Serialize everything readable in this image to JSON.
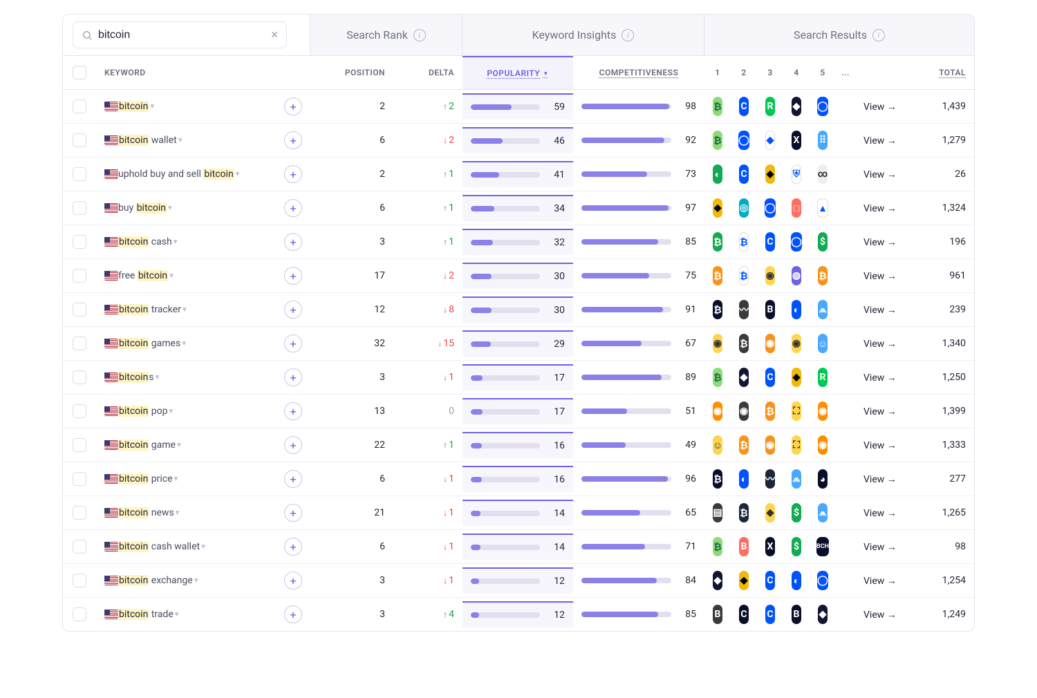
{
  "search": {
    "value": "bitcoin",
    "placeholder": ""
  },
  "topTabs": {
    "searchRank": "Search Rank",
    "keywordInsights": "Keyword Insights",
    "searchResults": "Search Results"
  },
  "columns": {
    "keyword": "KEYWORD",
    "position": "POSITION",
    "delta": "DELTA",
    "popularity": "POPULARITY",
    "competitiveness": "COMPETITIVENESS",
    "appCols": [
      "1",
      "2",
      "3",
      "4",
      "5"
    ],
    "moreCol": "...",
    "total": "TOTAL"
  },
  "sort": {
    "column": "popularity",
    "direction": "desc"
  },
  "viewLabel": "View →",
  "rows": [
    {
      "pre": "",
      "hl": "bitcoin",
      "post": "",
      "pos": 2,
      "delta": 2,
      "pop": 59,
      "comp": 98,
      "total": "1,439",
      "icons": [
        {
          "l": "₿",
          "c": 13
        },
        {
          "l": "C",
          "c": 2
        },
        {
          "l": "R",
          "c": 3
        },
        {
          "l": "◆",
          "c": 4
        },
        {
          "l": "◯",
          "c": 2
        }
      ]
    },
    {
      "pre": "",
      "hl": "bitcoin",
      "post": " wallet",
      "pos": 6,
      "delta": -2,
      "pop": 46,
      "comp": 92,
      "total": "1,279",
      "icons": [
        {
          "l": "₿",
          "c": 13
        },
        {
          "l": "◯",
          "c": 2
        },
        {
          "l": "◆",
          "c": 16
        },
        {
          "l": "X",
          "c": 1
        },
        {
          "l": "⠿",
          "c": 18
        }
      ]
    },
    {
      "pre": "uphold buy and sell ",
      "hl": "bitcoin",
      "post": "",
      "pos": 2,
      "delta": 1,
      "pop": 41,
      "comp": 73,
      "total": "26",
      "icons": [
        {
          "l": "◐",
          "c": 14
        },
        {
          "l": "C",
          "c": 2
        },
        {
          "l": "◆",
          "c": 17
        },
        {
          "l": "⛨",
          "c": 16
        },
        {
          "l": "∞",
          "c": 10
        }
      ]
    },
    {
      "pre": "buy ",
      "hl": "bitcoin",
      "post": "",
      "pos": 6,
      "delta": 1,
      "pop": 34,
      "comp": 97,
      "total": "1,324",
      "icons": [
        {
          "l": "◆",
          "c": 17
        },
        {
          "l": "◎",
          "c": 9
        },
        {
          "l": "◯",
          "c": 2
        },
        {
          "l": "□",
          "c": 7
        },
        {
          "l": "▲",
          "c": 16
        }
      ]
    },
    {
      "pre": "",
      "hl": "bitcoin",
      "post": " cash",
      "pos": 3,
      "delta": 1,
      "pop": 32,
      "comp": 85,
      "total": "196",
      "icons": [
        {
          "l": "₿",
          "c": 14
        },
        {
          "l": "₿",
          "c": 16
        },
        {
          "l": "C",
          "c": 2
        },
        {
          "l": "◯",
          "c": 2
        },
        {
          "l": "$",
          "c": 14
        }
      ]
    },
    {
      "pre": "free ",
      "hl": "bitcoin",
      "post": "",
      "pos": 17,
      "delta": -2,
      "pop": 30,
      "comp": 75,
      "total": "961",
      "icons": [
        {
          "l": "₿",
          "c": 5
        },
        {
          "l": "₿",
          "c": 16
        },
        {
          "l": "◉",
          "c": 6
        },
        {
          "l": "◍",
          "c": 8
        },
        {
          "l": "₿",
          "c": 5
        }
      ]
    },
    {
      "pre": "",
      "hl": "bitcoin",
      "post": " tracker",
      "pos": 12,
      "delta": -8,
      "pop": 30,
      "comp": 91,
      "total": "239",
      "icons": [
        {
          "l": "₿",
          "c": 1
        },
        {
          "l": "〰",
          "c": 12
        },
        {
          "l": "B",
          "c": 1
        },
        {
          "l": "◐",
          "c": 2
        },
        {
          "l": "⩕",
          "c": 18
        }
      ]
    },
    {
      "pre": "",
      "hl": "bitcoin",
      "post": " games",
      "pos": 32,
      "delta": -15,
      "pop": 29,
      "comp": 67,
      "total": "1,340",
      "icons": [
        {
          "l": "◉",
          "c": 6
        },
        {
          "l": "₿",
          "c": 12
        },
        {
          "l": "◉",
          "c": 5
        },
        {
          "l": "◉",
          "c": 6
        },
        {
          "l": "☺",
          "c": 18
        }
      ]
    },
    {
      "pre": "",
      "hl": "bitcoin",
      "post": "s",
      "pos": 3,
      "delta": -1,
      "pop": 17,
      "comp": 89,
      "total": "1,250",
      "icons": [
        {
          "l": "₿",
          "c": 13
        },
        {
          "l": "◆",
          "c": 4
        },
        {
          "l": "C",
          "c": 2
        },
        {
          "l": "◆",
          "c": 17
        },
        {
          "l": "R",
          "c": 3
        }
      ]
    },
    {
      "pre": "",
      "hl": "bitcoin",
      "post": " pop",
      "pos": 13,
      "delta": 0,
      "pop": 17,
      "comp": 51,
      "total": "1,399",
      "icons": [
        {
          "l": "◉",
          "c": 19
        },
        {
          "l": "◉",
          "c": 12
        },
        {
          "l": "₿",
          "c": 5
        },
        {
          "l": "⛶",
          "c": 6
        },
        {
          "l": "◉",
          "c": 19
        }
      ]
    },
    {
      "pre": "",
      "hl": "bitcoin",
      "post": " game",
      "pos": 22,
      "delta": 1,
      "pop": 16,
      "comp": 49,
      "total": "1,333",
      "icons": [
        {
          "l": "☺",
          "c": 6
        },
        {
          "l": "₿",
          "c": 5
        },
        {
          "l": "◉",
          "c": 5
        },
        {
          "l": "⛶",
          "c": 6
        },
        {
          "l": "◉",
          "c": 19
        }
      ]
    },
    {
      "pre": "",
      "hl": "bitcoin",
      "post": " price",
      "pos": 6,
      "delta": -1,
      "pop": 16,
      "comp": 96,
      "total": "277",
      "icons": [
        {
          "l": "₿",
          "c": 1
        },
        {
          "l": "◐",
          "c": 2
        },
        {
          "l": "〰",
          "c": 15
        },
        {
          "l": "⩕",
          "c": 18
        },
        {
          "l": "◕",
          "c": 1
        }
      ]
    },
    {
      "pre": "",
      "hl": "bitcoin",
      "post": " news",
      "pos": 21,
      "delta": -1,
      "pop": 14,
      "comp": 65,
      "total": "1,265",
      "icons": [
        {
          "l": "▤",
          "c": 12
        },
        {
          "l": "₿",
          "c": 15
        },
        {
          "l": "◆",
          "c": 6
        },
        {
          "l": "$",
          "c": 14
        },
        {
          "l": "⩕",
          "c": 18
        }
      ]
    },
    {
      "pre": "",
      "hl": "bitcoin",
      "post": " cash wallet",
      "pos": 6,
      "delta": -1,
      "pop": 14,
      "comp": 71,
      "total": "98",
      "icons": [
        {
          "l": "₿",
          "c": 13
        },
        {
          "l": "B",
          "c": 7
        },
        {
          "l": "X",
          "c": 1
        },
        {
          "l": "$",
          "c": 14
        },
        {
          "l": "BCH",
          "c": 1
        }
      ]
    },
    {
      "pre": "",
      "hl": "bitcoin",
      "post": " exchange",
      "pos": 3,
      "delta": -1,
      "pop": 12,
      "comp": 84,
      "total": "1,254",
      "icons": [
        {
          "l": "◆",
          "c": 4
        },
        {
          "l": "◆",
          "c": 17
        },
        {
          "l": "C",
          "c": 2
        },
        {
          "l": "◐",
          "c": 2
        },
        {
          "l": "◯",
          "c": 2
        }
      ]
    },
    {
      "pre": "",
      "hl": "bitcoin",
      "post": " trade",
      "pos": 3,
      "delta": 4,
      "pop": 12,
      "comp": 85,
      "total": "1,249",
      "icons": [
        {
          "l": "B",
          "c": 12
        },
        {
          "l": "C",
          "c": 1
        },
        {
          "l": "C",
          "c": 2
        },
        {
          "l": "B",
          "c": 1
        },
        {
          "l": "◆",
          "c": 4
        }
      ]
    }
  ]
}
